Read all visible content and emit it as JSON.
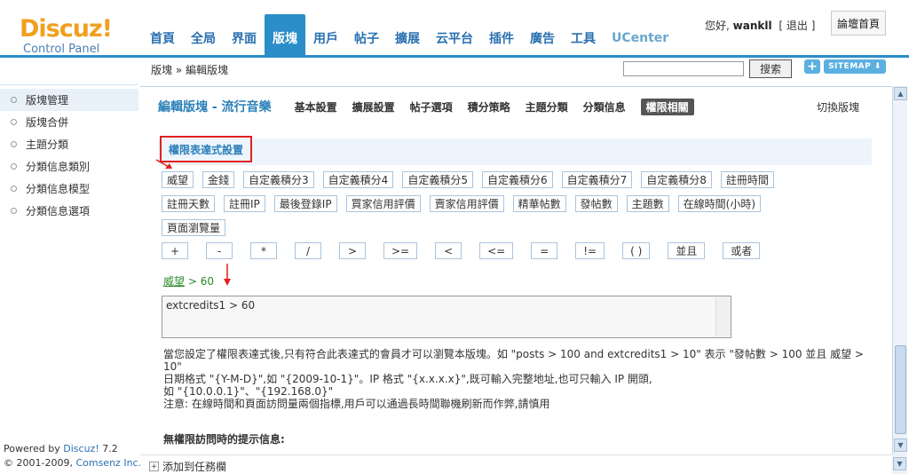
{
  "logo": {
    "brand": "Discuz!",
    "subtitle": "Control Panel"
  },
  "topnav": [
    {
      "label": "首頁"
    },
    {
      "label": "全局"
    },
    {
      "label": "界面"
    },
    {
      "label": "版塊"
    },
    {
      "label": "用戶"
    },
    {
      "label": "帖子"
    },
    {
      "label": "擴展"
    },
    {
      "label": "云平台"
    },
    {
      "label": "插件"
    },
    {
      "label": "廣告"
    },
    {
      "label": "工具"
    },
    {
      "label": "UCenter"
    }
  ],
  "user": {
    "greeting": "您好,",
    "name": "wankll",
    "logout": "[ 退出 ]"
  },
  "home_button": "論壇首頁",
  "breadcrumb": "版塊 » 編輯版塊",
  "search": {
    "value": "",
    "button": "搜索"
  },
  "sitemap_button": "SITEMAP",
  "sidebar": {
    "items": [
      {
        "label": "版塊管理"
      },
      {
        "label": "版塊合併"
      },
      {
        "label": "主題分類"
      },
      {
        "label": "分類信息類別"
      },
      {
        "label": "分類信息模型"
      },
      {
        "label": "分類信息選項"
      }
    ]
  },
  "powered": {
    "line1": "Powered by",
    "brand": "Discuz!",
    "version": "7.2",
    "line2": "© 2001-2009,",
    "company": "Comsenz Inc."
  },
  "page": {
    "title": "編輯版塊 - 流行音樂",
    "tabs": [
      {
        "label": "基本設置"
      },
      {
        "label": "擴展設置"
      },
      {
        "label": "帖子選項"
      },
      {
        "label": "積分策略"
      },
      {
        "label": "主題分類"
      },
      {
        "label": "分類信息"
      },
      {
        "label": "權限相關"
      }
    ],
    "switch": "切換版塊",
    "section_title": "權限表達式設置"
  },
  "variables_row1": [
    "威望",
    "金錢",
    "自定義積分3",
    "自定義積分4",
    "自定義積分5",
    "自定義積分6",
    "自定義積分7",
    "自定義積分8",
    "註冊時間"
  ],
  "variables_row2": [
    "註冊天數",
    "註冊IP",
    "最後登錄IP",
    "買家信用評價",
    "賣家信用評價",
    "精華帖數",
    "發帖數",
    "主題數",
    "在線時間(小時)"
  ],
  "variables_row3": [
    "頁面瀏覽量"
  ],
  "operators": [
    "+",
    "-",
    "*",
    "/",
    ">",
    ">=",
    "<",
    "<=",
    "=",
    "!=",
    "( )",
    "並且",
    "或者"
  ],
  "expression": {
    "term": "威望",
    "rest": " > 60",
    "textarea": "extcredits1 > 60"
  },
  "help": {
    "line1": "當您設定了權限表達式後,只有符合此表達式的會員才可以瀏覽本版塊。如 \"posts > 100 and extcredits1 > 10\" 表示 \"發帖數 > 100 並且 威望 > 10\"",
    "line2": "日期格式 \"{Y-M-D}\",如 \"{2009-10-1}\"。IP 格式 \"{x.x.x.x}\",既可輸入完整地址,也可只輸入 IP 開頭,",
    "line3": "如 \"{10.0.0.1}\"、\"{192.168.0}\"",
    "line4": "注意: 在線時間和頁面訪問量兩個指標,用戶可以通過長時間聯機刷新而作弊,請慎用"
  },
  "noperm_title": "無權限訪問時的提示信息:",
  "task_button": "添加到任務欄"
}
